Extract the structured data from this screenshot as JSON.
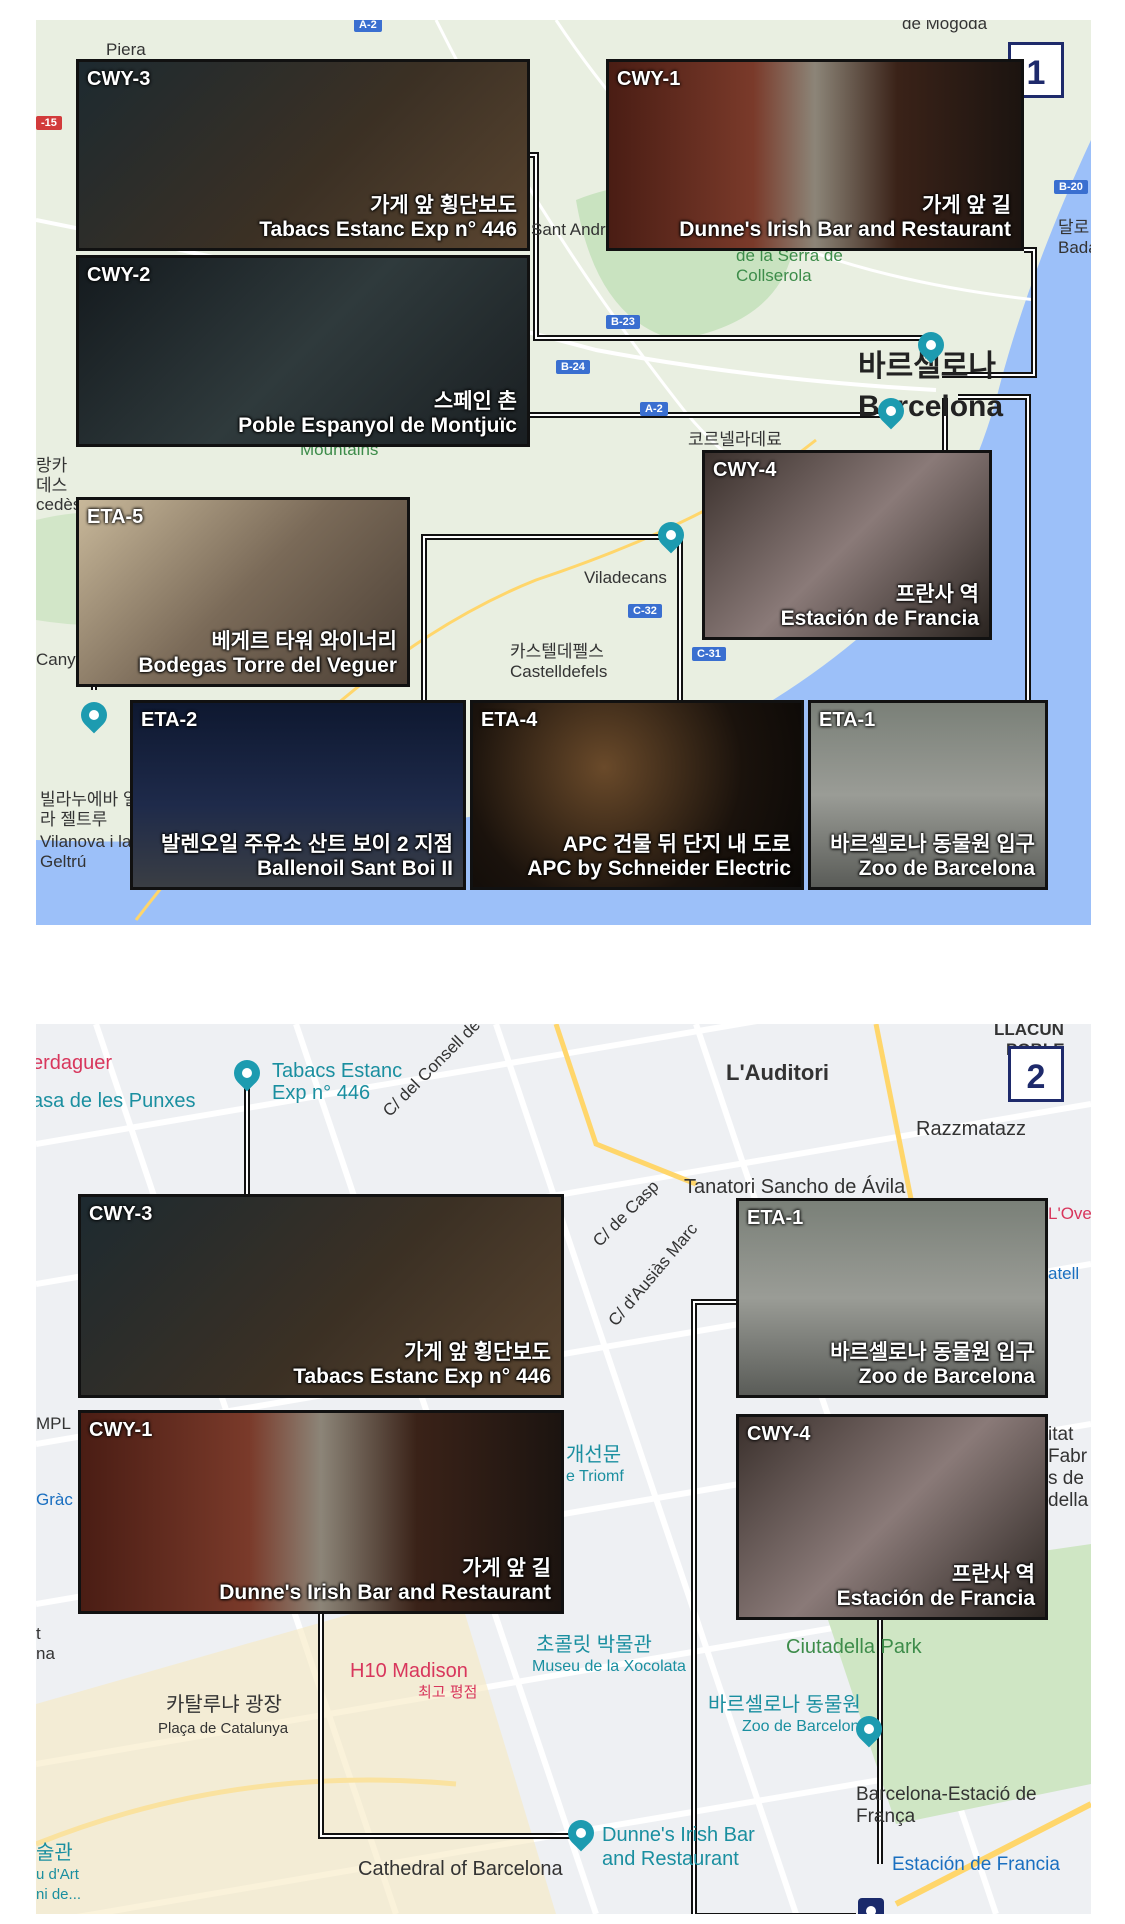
{
  "panel1": {
    "number": "1",
    "map_labels": [
      "de Mogoda",
      "Piera",
      "Sant Andreu de la Barca",
      "de la Serra de Collserola",
      "바르셀로나",
      "Barcelona",
      "코르넬라데료",
      "Viladecans",
      "카스텔데펠스",
      "Castelldefels",
      "Mountains",
      "빌라누에바 일라 젤트루",
      "Vilanova i la Geltrú",
      "랑카 데스 cedès",
      "Cany",
      "달로 Badalo"
    ],
    "road_shields": [
      "A-2",
      "B-23",
      "B-24",
      "A-2",
      "C-32",
      "C-31",
      "B-20",
      "-15"
    ],
    "cards": [
      {
        "tag": "CWY-3",
        "line1": "가게 앞 횡단보도",
        "line2": "Tabacs Estanc Exp n° 446"
      },
      {
        "tag": "CWY-1",
        "line1": "가게 앞 길",
        "line2": "Dunne's Irish Bar and Restaurant"
      },
      {
        "tag": "CWY-2",
        "line1": "스페인 촌",
        "line2": "Poble Espanyol de Montjuïc"
      },
      {
        "tag": "CWY-4",
        "line1": "프란사 역",
        "line2": "Estación de Francia"
      },
      {
        "tag": "ETA-5",
        "line1": "베게르 타워 와이너리",
        "line2": "Bodegas Torre del Veguer"
      },
      {
        "tag": "ETA-2",
        "line1": "발렌오일 주유소 산트 보이 2 지점",
        "line2": "Ballenoil Sant Boi II"
      },
      {
        "tag": "ETA-4",
        "line1": "APC 건물 뒤 단지 내 도로",
        "line2": "APC by Schneider Electric"
      },
      {
        "tag": "ETA-1",
        "line1": "바르셀로나 동물원 입구",
        "line2": "Zoo de Barcelona"
      }
    ]
  },
  "panel2": {
    "number": "2",
    "map_labels": [
      "erdaguer",
      "asa de les Punxes",
      "Tabacs Estanc",
      "Exp n° 446",
      "C/ del Consell de Cent",
      "L'Auditori",
      "Razzmatazz",
      "Tanatori Sancho de Ávila",
      "C/ de Casp",
      "C/ d'Ausiàs Marc",
      "개선문",
      "e Triomf",
      "MPL",
      "Gràc",
      "t na",
      "카탈루냐 광장",
      "Plaça de Catalunya",
      "H10 Madison",
      "최고 평점",
      "초콜릿 박물관",
      "Museu de la Xocolata",
      "바르셀로나 동물원",
      "Zoo de Barcelona",
      "Ciutadella Park",
      "Barcelona-Estació de França",
      "Estación de Francia",
      "Dunne's Irish Bar",
      "and Restaurant",
      "Cathedral of Barcelona",
      "술관",
      "u d'Art",
      "ni de...",
      "LLACUN",
      "POBLE",
      "L'Ove",
      "atell",
      "itat Fabr s de della"
    ],
    "cards": [
      {
        "tag": "CWY-3",
        "line1": "가게 앞 횡단보도",
        "line2": "Tabacs Estanc Exp n° 446"
      },
      {
        "tag": "CWY-1",
        "line1": "가게 앞 길",
        "line2": "Dunne's Irish Bar and Restaurant"
      },
      {
        "tag": "ETA-1",
        "line1": "바르셀로나 동물원 입구",
        "line2": "Zoo de Barcelona"
      },
      {
        "tag": "CWY-4",
        "line1": "프란사 역",
        "line2": "Estación de Francia"
      }
    ]
  },
  "colors": {
    "water": "#9cc0f9",
    "land": "#e9efe1",
    "green": "#c9e3c0",
    "pin": "#1d9bb0",
    "road": "#ffffff",
    "number_box": "#1e2a6b"
  }
}
